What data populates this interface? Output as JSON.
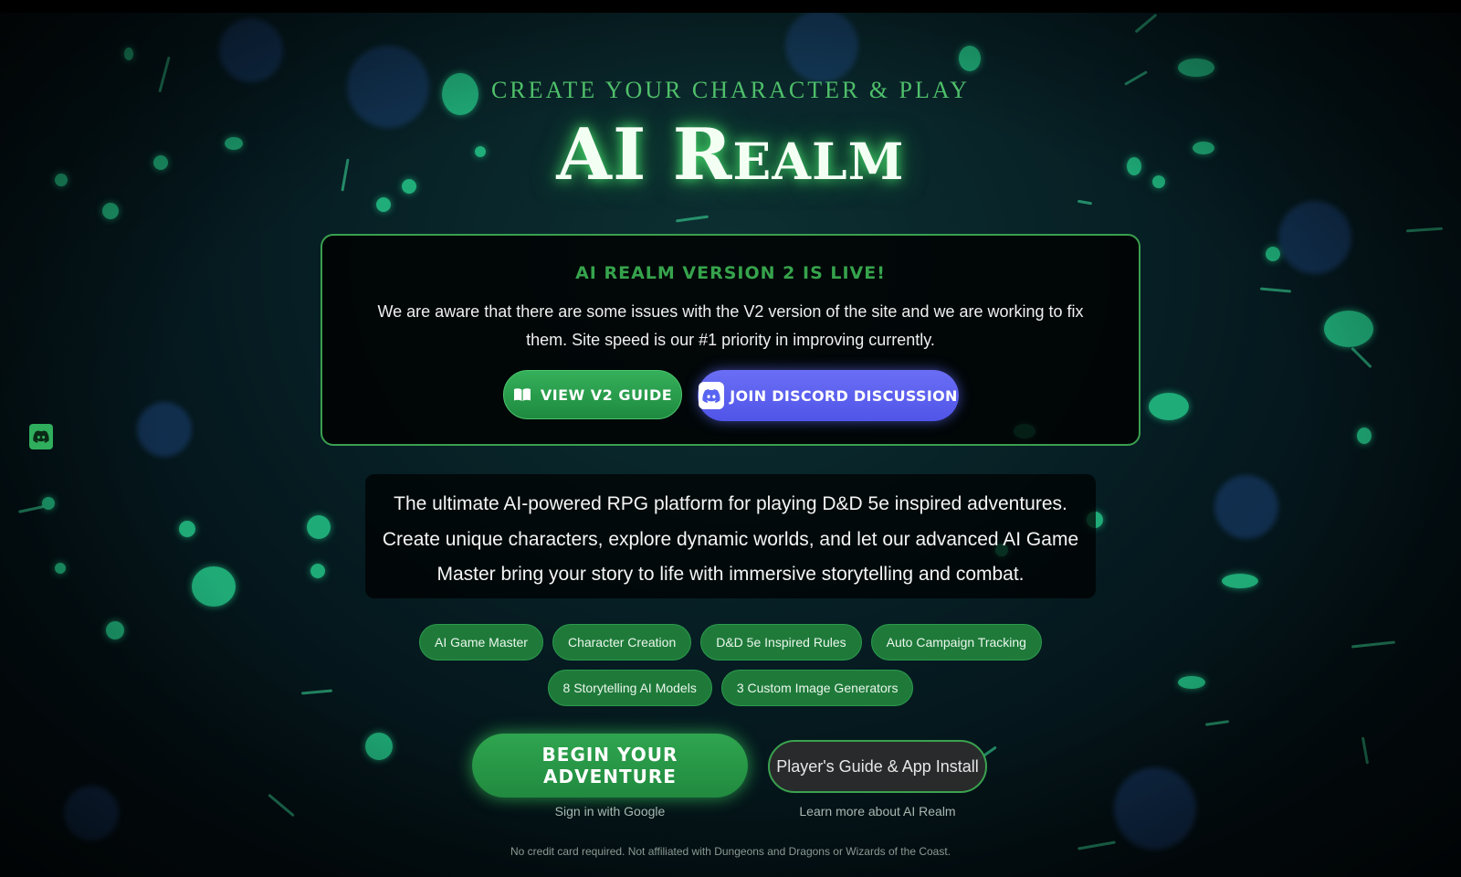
{
  "hero": {
    "tagline": "Create Your Character & Play",
    "title": "AI Realm"
  },
  "announcement": {
    "title": "AI REALM VERSION 2 IS LIVE!",
    "body": "We are aware that there are some issues with the V2 version of the site and we are working to fix them. Site speed is our #1 priority in improving currently.",
    "guide_button": "VIEW V2 GUIDE",
    "discord_button": "JOIN DISCORD DISCUSSION"
  },
  "description": "The ultimate AI-powered RPG platform for playing D&D 5e inspired adventures. Create unique characters, explore dynamic worlds, and let our advanced AI Game Master bring your story to life with immersive storytelling and combat.",
  "features": {
    "row1": [
      "AI Game Master",
      "Character Creation",
      "D&D 5e Inspired Rules",
      "Auto Campaign Tracking"
    ],
    "row2": [
      "8 Storytelling AI Models",
      "3 Custom Image Generators"
    ]
  },
  "cta": {
    "primary_label": "BEGIN YOUR ADVENTURE",
    "primary_sub": "Sign in with Google",
    "secondary_label": "Player's Guide & App Install",
    "secondary_sub": "Learn more about AI Realm"
  },
  "footer": "No credit card required. Not affiliated with Dungeons and Dragons or Wizards of the Coast.",
  "colors": {
    "accent_green": "#2fa54f",
    "discord_blurple": "#5865f2",
    "background": "#04161a"
  },
  "icons": {
    "side_discord": "discord-icon",
    "guide": "book-icon",
    "discord": "discord-icon"
  }
}
